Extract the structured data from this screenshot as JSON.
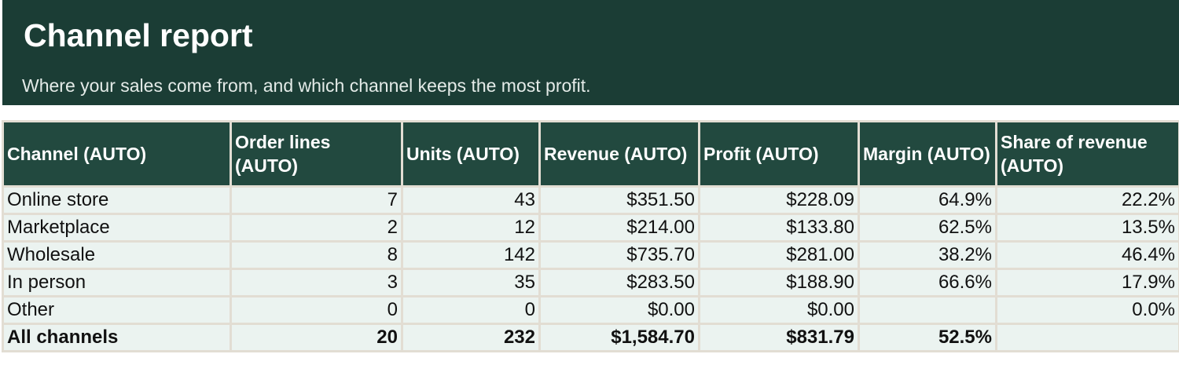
{
  "header": {
    "title": "Channel report",
    "subtitle": "Where your sales come from, and which channel keeps the most profit."
  },
  "table": {
    "columns": [
      "Channel (AUTO)",
      "Order lines (AUTO)",
      "Units (AUTO)",
      "Revenue (AUTO)",
      "Profit (AUTO)",
      "Margin (AUTO)",
      "Share of revenue (AUTO)"
    ],
    "rows": [
      [
        "Online store",
        "7",
        "43",
        "$351.50",
        "$228.09",
        "64.9%",
        "22.2%"
      ],
      [
        "Marketplace",
        "2",
        "12",
        "$214.00",
        "$133.80",
        "62.5%",
        "13.5%"
      ],
      [
        "Wholesale",
        "8",
        "142",
        "$735.70",
        "$281.00",
        "38.2%",
        "46.4%"
      ],
      [
        "In person",
        "3",
        "35",
        "$283.50",
        "$188.90",
        "66.6%",
        "17.9%"
      ],
      [
        "Other",
        "0",
        "0",
        "$0.00",
        "$0.00",
        "",
        "0.0%"
      ]
    ],
    "total": [
      "All channels",
      "20",
      "232",
      "$1,584.70",
      "$831.79",
      "52.5%",
      ""
    ]
  },
  "colors": {
    "header_bg": "#1b3d35",
    "column_header_bg": "#22493f",
    "cell_bg": "#ebf3f0",
    "grid_line": "#e2ddd3"
  }
}
